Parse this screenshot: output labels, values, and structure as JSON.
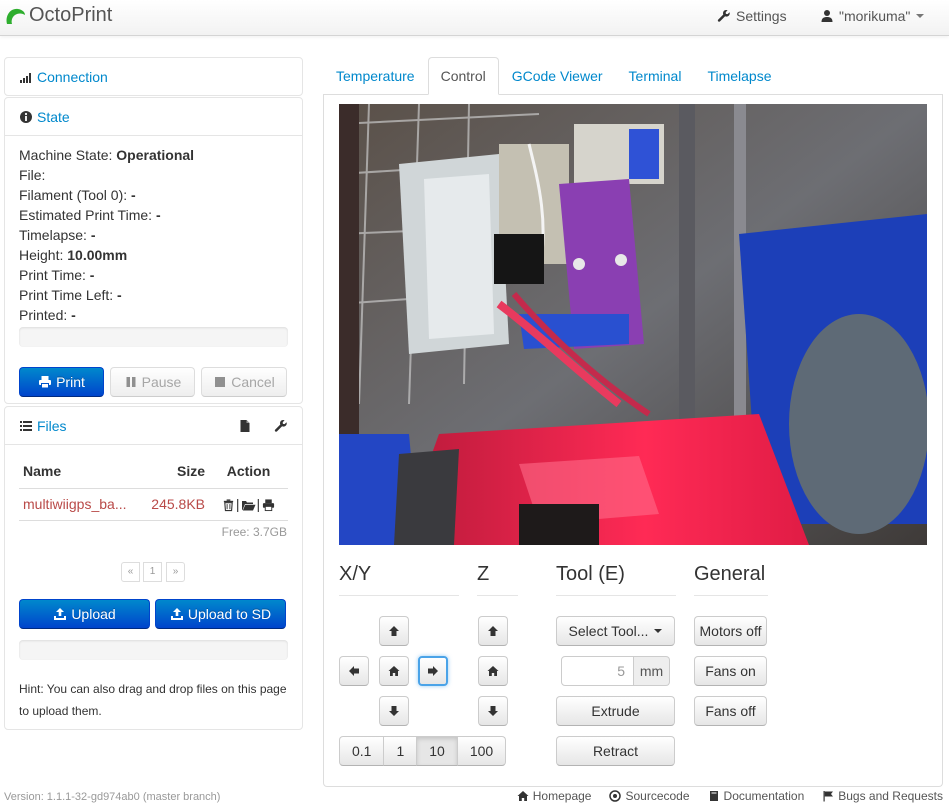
{
  "app": {
    "title": "OctoPrint"
  },
  "navbar": {
    "settings_label": "Settings",
    "user_label": "\"morikuma\""
  },
  "sidebar": {
    "connection": {
      "title": "Connection"
    },
    "state": {
      "title": "State",
      "rows": [
        {
          "label": "Machine State: ",
          "value": "Operational"
        },
        {
          "label": "File: ",
          "value": ""
        },
        {
          "label": "Filament (Tool 0): ",
          "value": "-"
        },
        {
          "label": "Estimated Print Time: ",
          "value": "-"
        },
        {
          "label": "Timelapse: ",
          "value": "-"
        },
        {
          "label": "Height: ",
          "value": "10.00mm"
        },
        {
          "label": "Print Time: ",
          "value": "-"
        },
        {
          "label": "Print Time Left: ",
          "value": "-"
        },
        {
          "label": "Printed: ",
          "value": "-"
        }
      ],
      "progress": 0,
      "buttons": {
        "print": "Print",
        "pause": "Pause",
        "cancel": "Cancel"
      }
    },
    "files": {
      "title": "Files",
      "columns": {
        "name": "Name",
        "size": "Size",
        "action": "Action"
      },
      "rows": [
        {
          "name": "multiwiigps_ba...",
          "size": "245.8KB"
        }
      ],
      "free": "Free: 3.7GB",
      "pagination": {
        "prev": "«",
        "page": "1",
        "next": "»"
      },
      "upload_label": "Upload",
      "upload_sd_label": "Upload to SD",
      "upload_progress": 0,
      "hint": "Hint: You can also drag and drop files on this page to upload them."
    }
  },
  "tabs": [
    {
      "label": "Temperature",
      "active": false
    },
    {
      "label": "Control",
      "active": true
    },
    {
      "label": "GCode Viewer",
      "active": false
    },
    {
      "label": "Terminal",
      "active": false
    },
    {
      "label": "Timelapse",
      "active": false
    }
  ],
  "control": {
    "headings": {
      "xy": "X/Y",
      "z": "Z",
      "tool": "Tool (E)",
      "general": "General"
    },
    "step_sizes": [
      "0.1",
      "1",
      "10",
      "100"
    ],
    "active_step": "10",
    "tool": {
      "select_label": "Select Tool...",
      "amount": "5",
      "unit": "mm",
      "extrude_label": "Extrude",
      "retract_label": "Retract"
    },
    "general": {
      "motors_off": "Motors off",
      "fans_on": "Fans on",
      "fans_off": "Fans off"
    }
  },
  "footer": {
    "version": "Version: 1.1.1-32-gd974ab0 (master branch)",
    "links": {
      "homepage": "Homepage",
      "sourcecode": "Sourcecode",
      "documentation": "Documentation",
      "bugs": "Bugs and Requests"
    }
  },
  "colors": {
    "link": "#0088cc",
    "primary": "#0055cc",
    "file_name": "#b94a48"
  }
}
